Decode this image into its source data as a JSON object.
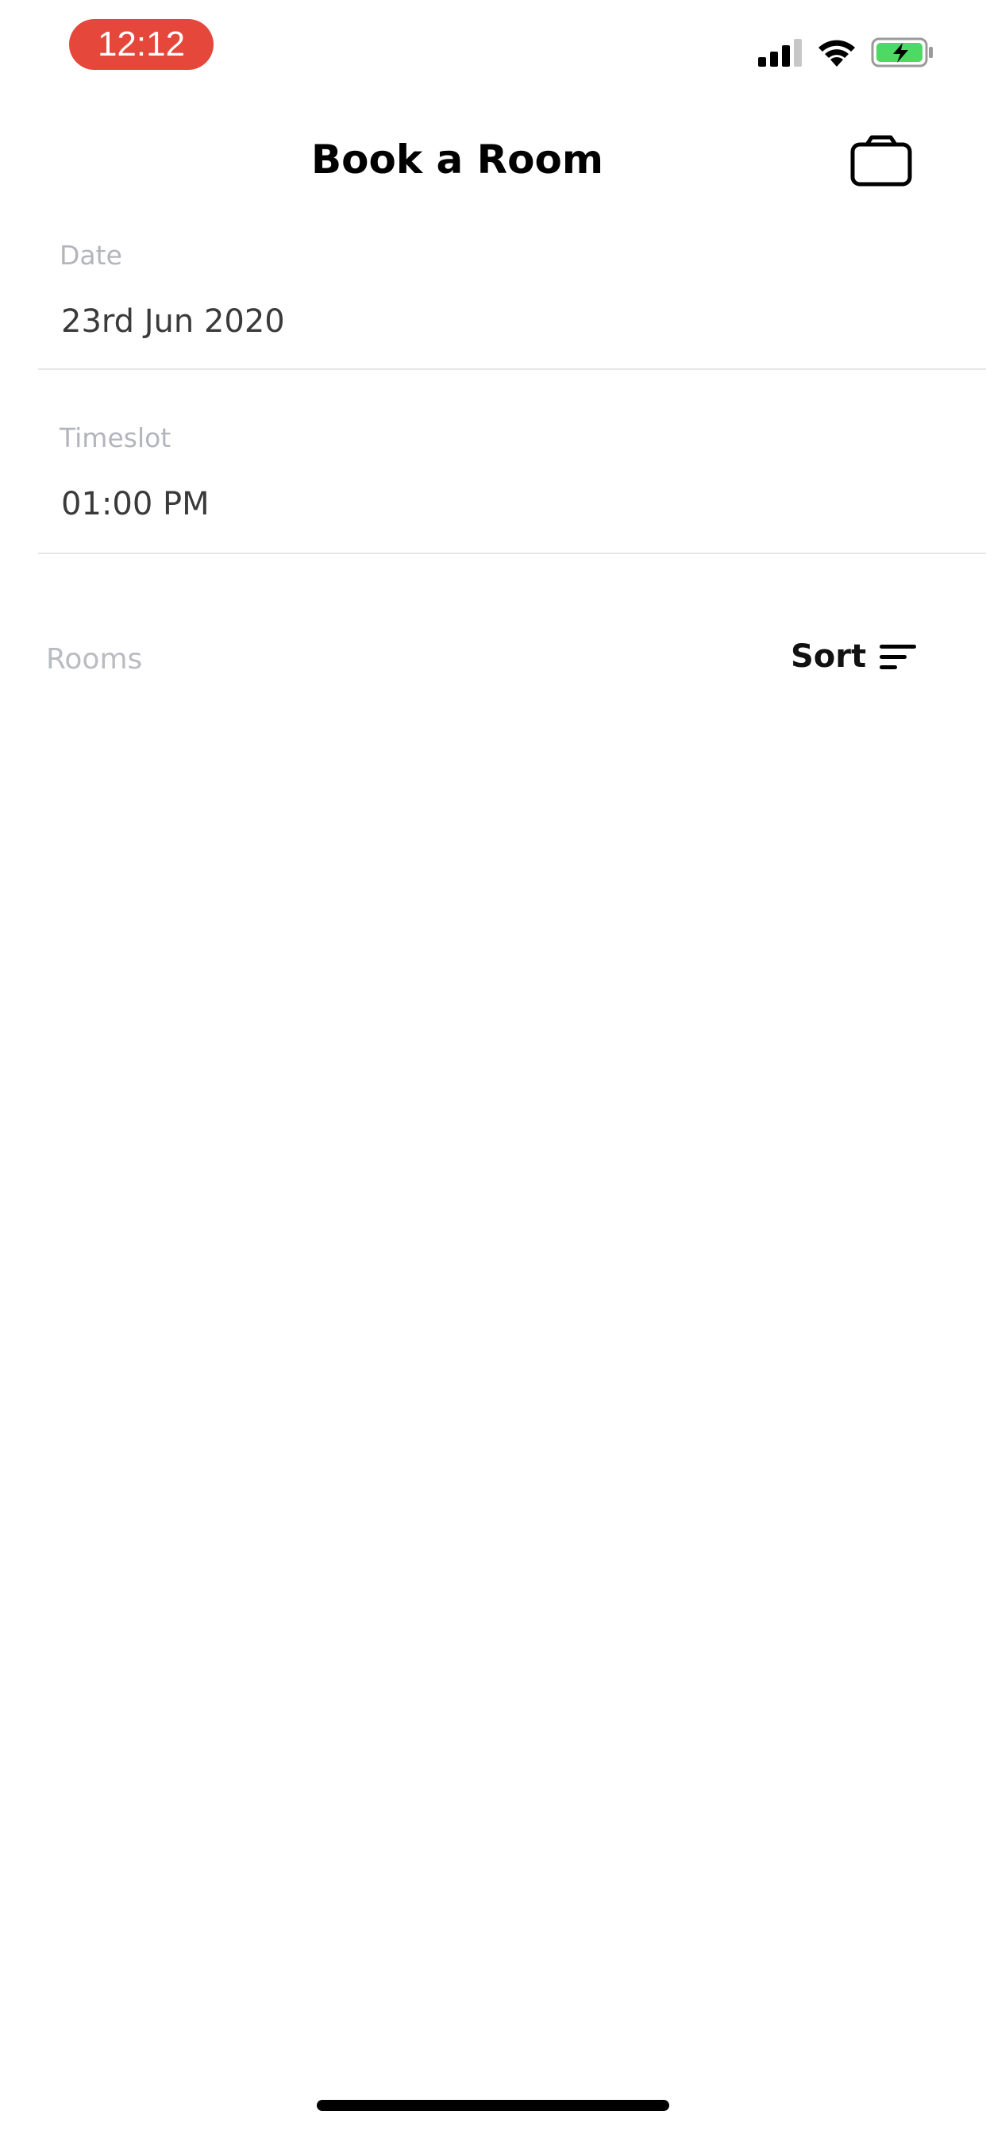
{
  "status_bar": {
    "time": "12:12",
    "time_pill_color": "#e5473b",
    "battery_color": "#4cd964"
  },
  "header": {
    "title": "Book a Room",
    "right_icon": "shopping-bag-icon"
  },
  "form": {
    "date": {
      "label": "Date",
      "value": "23rd Jun 2020"
    },
    "timeslot": {
      "label": "Timeslot",
      "value": "01:00 PM"
    }
  },
  "rooms": {
    "label": "Rooms",
    "sort_label": "Sort",
    "sort_icon": "sort-icon",
    "items": []
  }
}
